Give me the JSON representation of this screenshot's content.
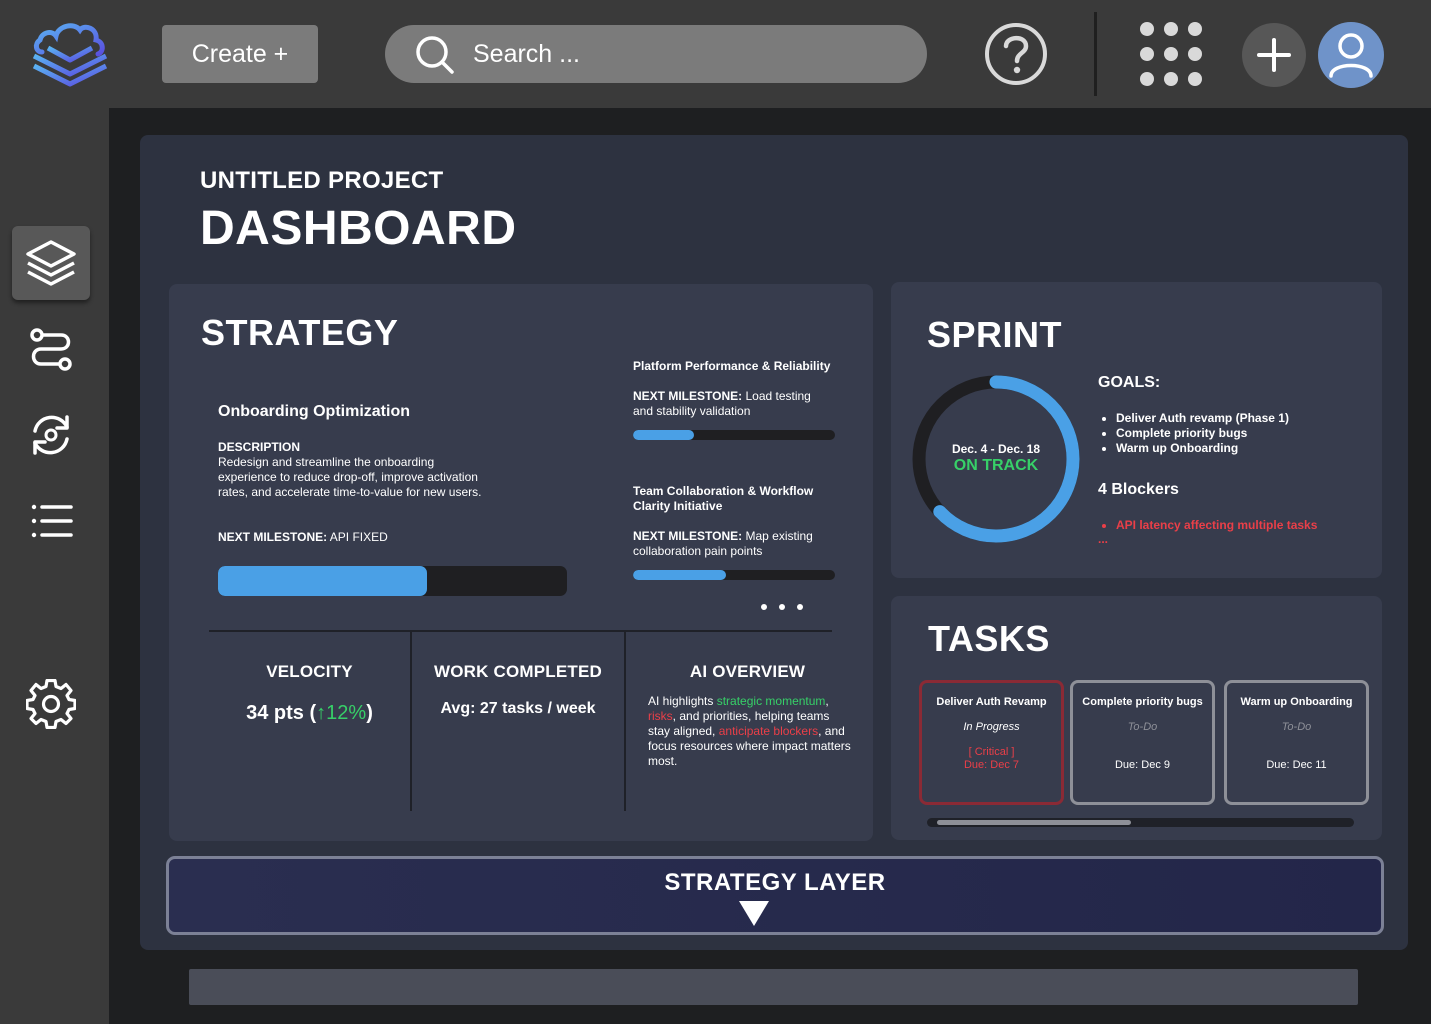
{
  "topbar": {
    "create_label": "Create +",
    "search_placeholder": "Search ..."
  },
  "page": {
    "project_name": "UNTITLED PROJECT",
    "title": "DASHBOARD"
  },
  "strategy": {
    "title": "STRATEGY",
    "initiatives": [
      {
        "title": "Onboarding Optimization",
        "description_label": "DESCRIPTION",
        "description": "Redesign and streamline the onboarding experience to reduce drop-off, improve activation rates, and accelerate time-to-value for new users.",
        "milestone_label": "NEXT MILESTONE:",
        "milestone": "API FIXED",
        "progress": 0.6
      },
      {
        "title": "Platform Performance & Reliability",
        "milestone_label": "NEXT MILESTONE:",
        "milestone": "Load testing and stability validation",
        "progress": 0.3
      },
      {
        "title": "Team Collaboration & Workflow Clarity Initiative",
        "milestone_label": "NEXT MILESTONE:",
        "milestone": "Map existing collaboration pain points",
        "progress": 0.46
      }
    ],
    "velocity": {
      "label": "VELOCITY",
      "value": "34 pts (",
      "delta_arrow": "↑",
      "delta": "12%",
      "close": ")"
    },
    "work_completed": {
      "label": "WORK COMPLETED",
      "value": "Avg: 27 tasks / week"
    },
    "ai_overview": {
      "label": "AI OVERVIEW",
      "t1": "AI highlights ",
      "h1": "strategic momentum",
      "t2": ", ",
      "h2": "risks",
      "t3": ", and priorities, helping teams stay aligned, ",
      "h3": "anticipate blockers",
      "t4": ", and focus resources where impact matters most."
    }
  },
  "sprint": {
    "title": "SPRINT",
    "dates": "Dec. 4 - Dec. 18",
    "status": "ON TRACK",
    "progress": 0.63,
    "goals_label": "GOALS:",
    "goals": [
      "Deliver Auth revamp (Phase 1)",
      "Complete priority bugs",
      "Warm up Onboarding"
    ],
    "blockers_label": "4 Blockers",
    "blockers": [
      "API latency affecting multiple tasks"
    ],
    "blockers_more": "..."
  },
  "tasks": {
    "title": "TASKS",
    "items": [
      {
        "title": "Deliver Auth Revamp",
        "status": "In Progress",
        "flag": "[ Critical ]",
        "due": "Due: Dec 7"
      },
      {
        "title": "Complete priority bugs",
        "status": "To-Do",
        "due": "Due: Dec 9"
      },
      {
        "title": "Warm up Onboarding",
        "status": "To-Do",
        "due": "Due: Dec 11"
      }
    ]
  },
  "layer": {
    "label": "STRATEGY LAYER"
  },
  "colors": {
    "accent_blue": "#4aa0e6",
    "success_green": "#37d068",
    "danger_red": "#ea3f48",
    "panel": "#2d3240",
    "card": "#373c4d"
  },
  "icons": {
    "logo": "cloud-layers-logo",
    "search": "search-icon",
    "help": "help-circle-icon",
    "apps": "apps-grid-icon",
    "add": "plus-icon",
    "avatar": "user-avatar-icon",
    "sidebar": [
      "layers-icon",
      "route-icon",
      "sync-icon",
      "list-icon",
      "gear-icon"
    ]
  }
}
